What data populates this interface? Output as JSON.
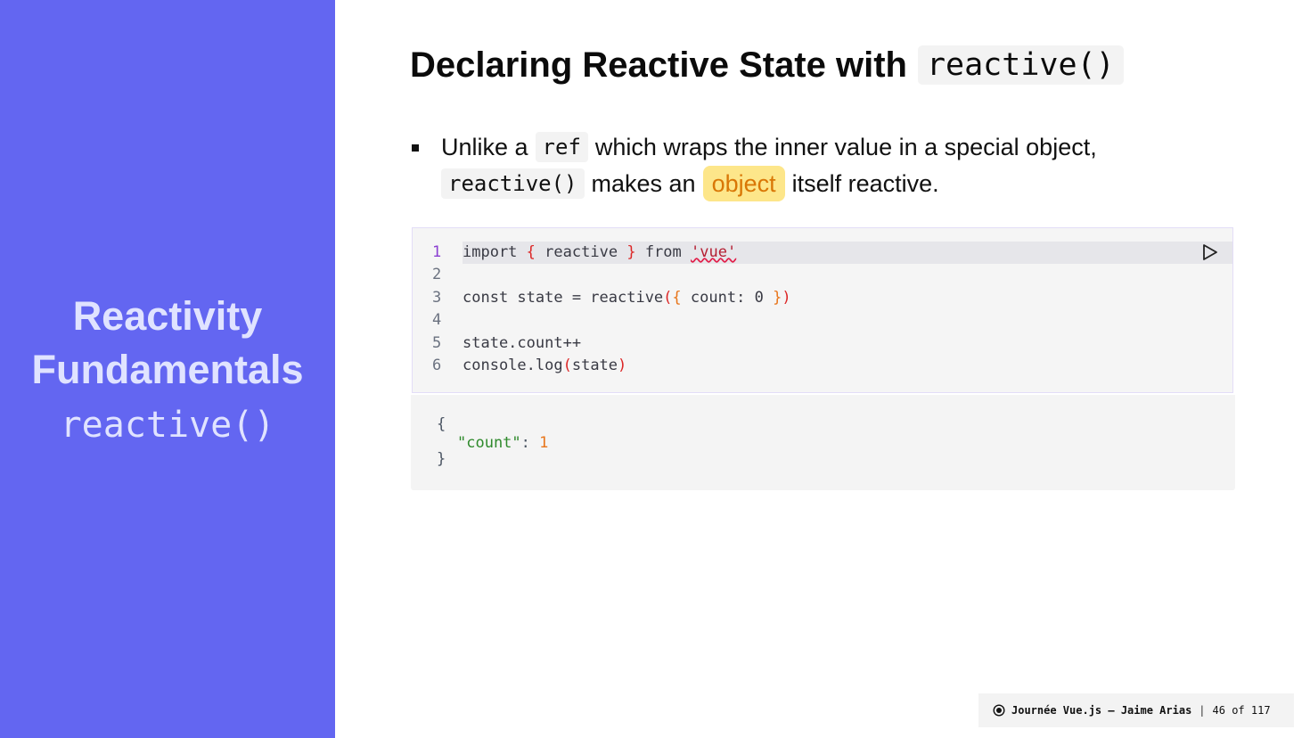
{
  "sidebar": {
    "title_line1": "Reactivity",
    "title_line2": "Fundamentals",
    "code": "reactive()",
    "bg_color": "#6366f1"
  },
  "heading": {
    "text": "Declaring Reactive State with",
    "code": "reactive()"
  },
  "bullet": {
    "part1": "Unlike a",
    "code1": "ref",
    "part2": "which wraps the inner value in a special object,",
    "code2": "reactive()",
    "part3": "makes an",
    "highlight": "object",
    "part4": "itself reactive."
  },
  "code_editor": {
    "line_numbers": [
      "1",
      "2",
      "3",
      "4",
      "5",
      "6"
    ],
    "line1": {
      "kw1": "import",
      "b1": "{",
      "mid": "reactive",
      "b2": "}",
      "kw2": "from",
      "str": "'vue'"
    },
    "line3": {
      "pre": "const state = reactive",
      "p1": "(",
      "b1": "{",
      "mid": "count: 0",
      "b2": "}",
      "p2": ")"
    },
    "line5": "state.count++",
    "line6": {
      "pre": "console.log",
      "p1": "(",
      "mid": "state",
      "p2": ")"
    },
    "run_icon": "play-icon"
  },
  "output": {
    "open": "{",
    "key": "\"count\"",
    "colon": ": ",
    "value": "1",
    "close": "}"
  },
  "footer": {
    "logo_icon": "target-icon",
    "text": "Journée Vue.js — Jaime Arias",
    "separator": "|",
    "page": "46 of 117"
  }
}
